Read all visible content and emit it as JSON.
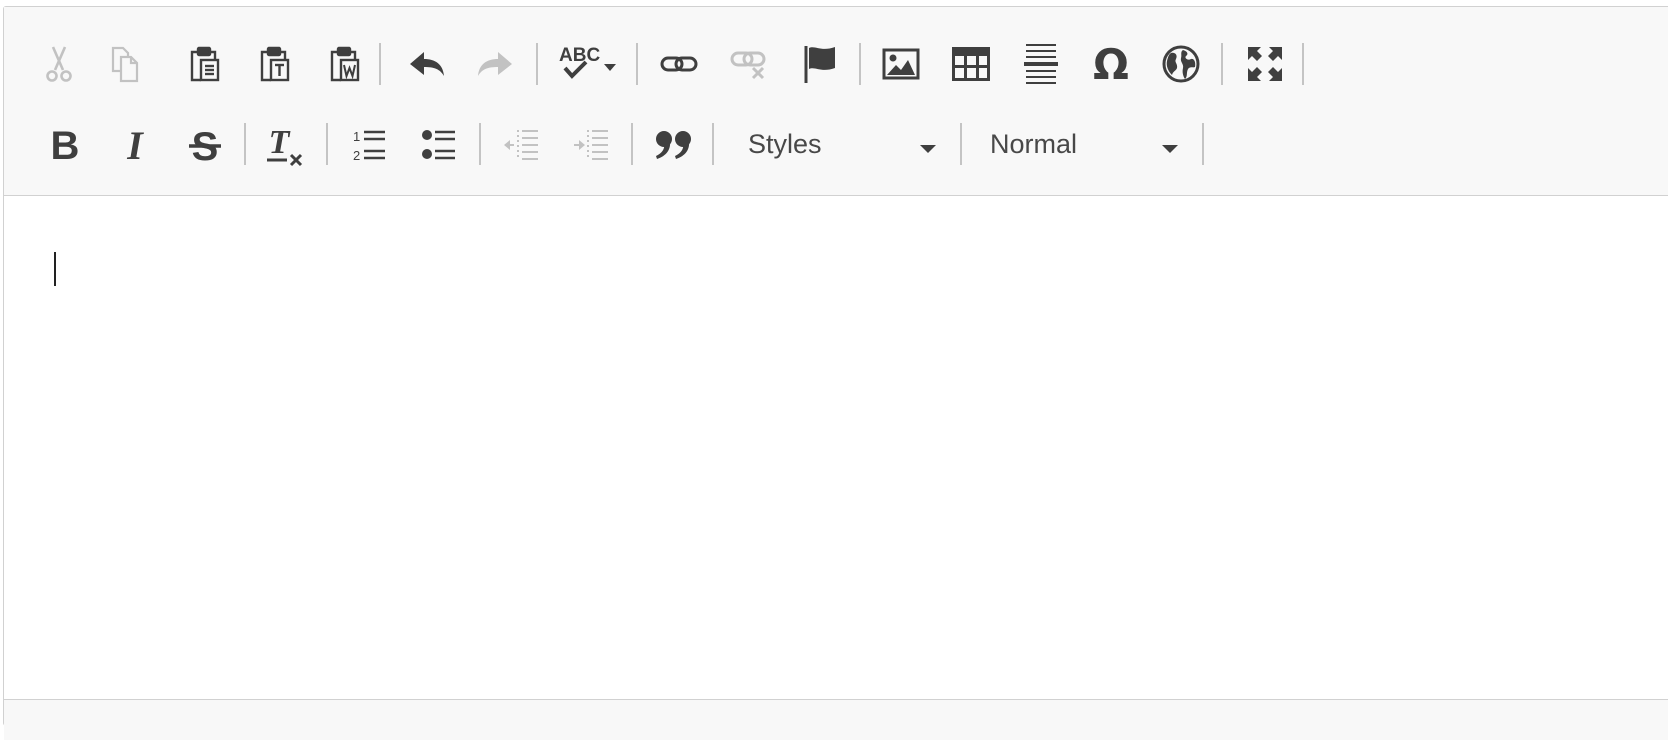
{
  "toolbar": {
    "row1": [
      {
        "icon": "cut-icon",
        "tooltip": "Cut",
        "enabled": false
      },
      {
        "icon": "copy-icon",
        "tooltip": "Copy",
        "enabled": false
      },
      {
        "icon": "paste-icon",
        "tooltip": "Paste",
        "enabled": true
      },
      {
        "icon": "paste-text-icon",
        "tooltip": "Paste as plain text",
        "enabled": true
      },
      {
        "icon": "paste-word-icon",
        "tooltip": "Paste from Word",
        "enabled": true
      },
      {
        "icon": "undo-icon",
        "tooltip": "Undo",
        "enabled": true
      },
      {
        "icon": "redo-icon",
        "tooltip": "Redo",
        "enabled": false
      },
      {
        "icon": "spellcheck-icon",
        "tooltip": "Spell Checker",
        "glyph_text": "ABC",
        "enabled": true
      },
      {
        "icon": "link-icon",
        "tooltip": "Link",
        "enabled": true
      },
      {
        "icon": "unlink-icon",
        "tooltip": "Unlink",
        "enabled": false
      },
      {
        "icon": "anchor-flag-icon",
        "tooltip": "Anchor",
        "enabled": true
      },
      {
        "icon": "image-icon",
        "tooltip": "Image",
        "enabled": true
      },
      {
        "icon": "table-icon",
        "tooltip": "Table",
        "enabled": true
      },
      {
        "icon": "horizontal-line-icon",
        "tooltip": "Insert Horizontal Line",
        "enabled": true
      },
      {
        "icon": "special-char-icon",
        "tooltip": "Insert Special Character",
        "glyph_text": "Ω",
        "enabled": true
      },
      {
        "icon": "globe-icon",
        "tooltip": "Language",
        "enabled": true
      },
      {
        "icon": "maximize-icon",
        "tooltip": "Maximize",
        "enabled": true
      }
    ],
    "row2": [
      {
        "icon": "bold-icon",
        "tooltip": "Bold",
        "glyph_text": "B",
        "enabled": true
      },
      {
        "icon": "italic-icon",
        "tooltip": "Italic",
        "glyph_text": "I",
        "enabled": true
      },
      {
        "icon": "strikethrough-icon",
        "tooltip": "Strikethrough",
        "glyph_text": "S",
        "enabled": true
      },
      {
        "icon": "remove-format-icon",
        "tooltip": "Remove Format",
        "glyph_text": "T",
        "enabled": true
      },
      {
        "icon": "numbered-list-icon",
        "tooltip": "Insert/Remove Numbered List",
        "enabled": true
      },
      {
        "icon": "bulleted-list-icon",
        "tooltip": "Insert/Remove Bulleted List",
        "enabled": true
      },
      {
        "icon": "outdent-icon",
        "tooltip": "Decrease Indent",
        "enabled": false
      },
      {
        "icon": "indent-icon",
        "tooltip": "Increase Indent",
        "enabled": false
      },
      {
        "icon": "blockquote-icon",
        "tooltip": "Block Quote",
        "enabled": true
      }
    ],
    "styles_combo": {
      "label": "Styles"
    },
    "format_combo": {
      "label": "Normal"
    }
  },
  "colors": {
    "icon_active": "#3f3f3f",
    "icon_disabled": "#c2c2c2",
    "toolbar_bg": "#f8f8f8",
    "border": "#d1d1d1"
  }
}
